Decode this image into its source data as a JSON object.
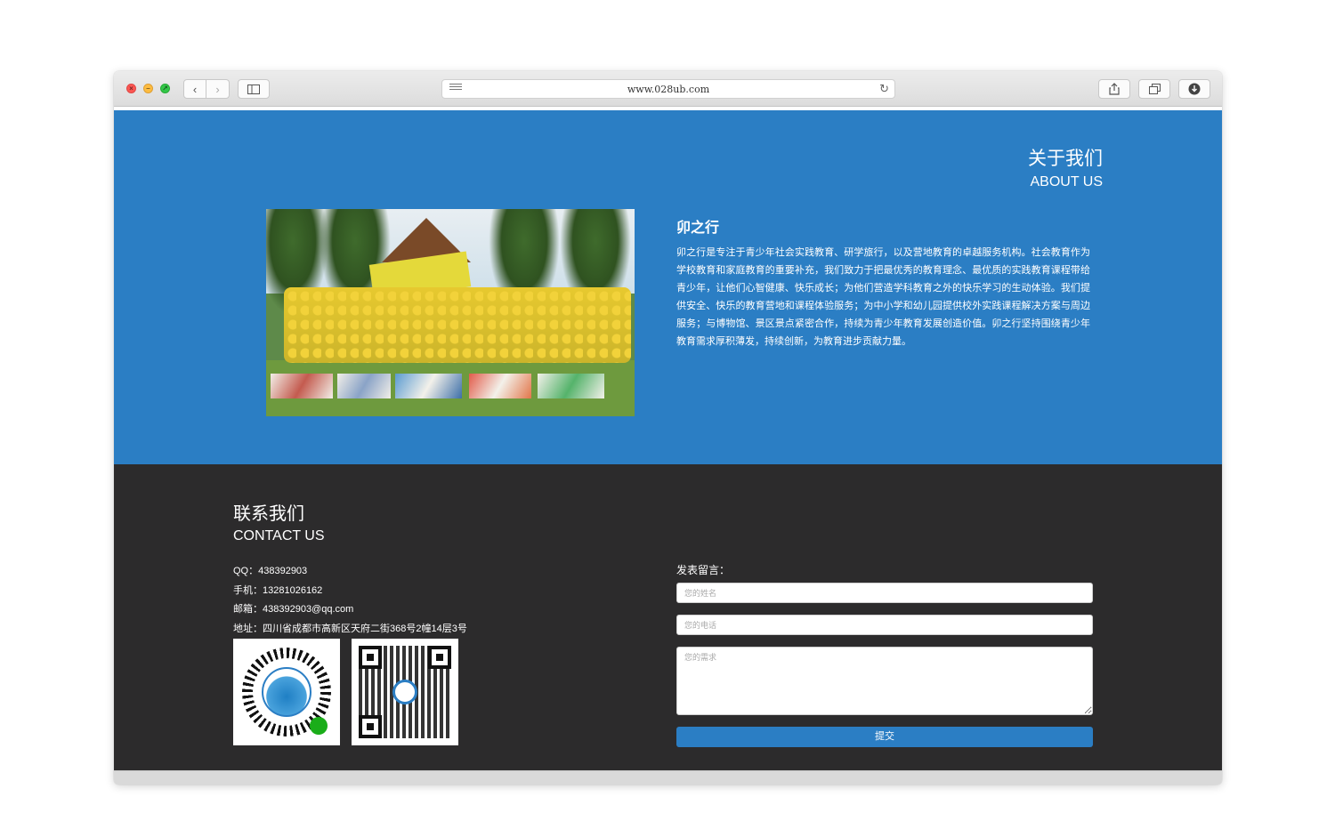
{
  "browser": {
    "url": "www.028ub.com"
  },
  "about": {
    "title_cn": "关于我们",
    "title_en": "ABOUT US",
    "name": "卯之行",
    "description": "卯之行是专注于青少年社会实践教育、研学旅行，以及营地教育的卓越服务机构。社会教育作为学校教育和家庭教育的重要补充，我们致力于把最优秀的教育理念、最优质的实践教育课程带给青少年，让他们心智健康、快乐成长；为他们营造学科教育之外的快乐学习的生动体验。我们提供安全、快乐的教育营地和课程体验服务；为中小学和幼儿园提供校外实践课程解决方案与周边服务；与博物馆、景区景点紧密合作，持续为青少年教育发展创造价值。卯之行坚持围绕青少年教育需求厚积薄发，持续创新，为教育进步贡献力量。"
  },
  "contact": {
    "title_cn": "联系我们",
    "title_en": "CONTACT US",
    "qq": "QQ：438392903",
    "phone": "手机：13281026162",
    "email": "邮箱：438392903@qq.com",
    "address": "地址：四川省成都市高新区天府二街368号2幢14层3号"
  },
  "form": {
    "label": "发表留言：",
    "name_placeholder": "您的姓名",
    "phone_placeholder": "您的电话",
    "message_placeholder": "您的需求",
    "submit_label": "提交"
  },
  "colors": {
    "about_bg": "#2b7ec4",
    "contact_bg": "#2c2b2c",
    "accent": "#2b7ec4"
  }
}
